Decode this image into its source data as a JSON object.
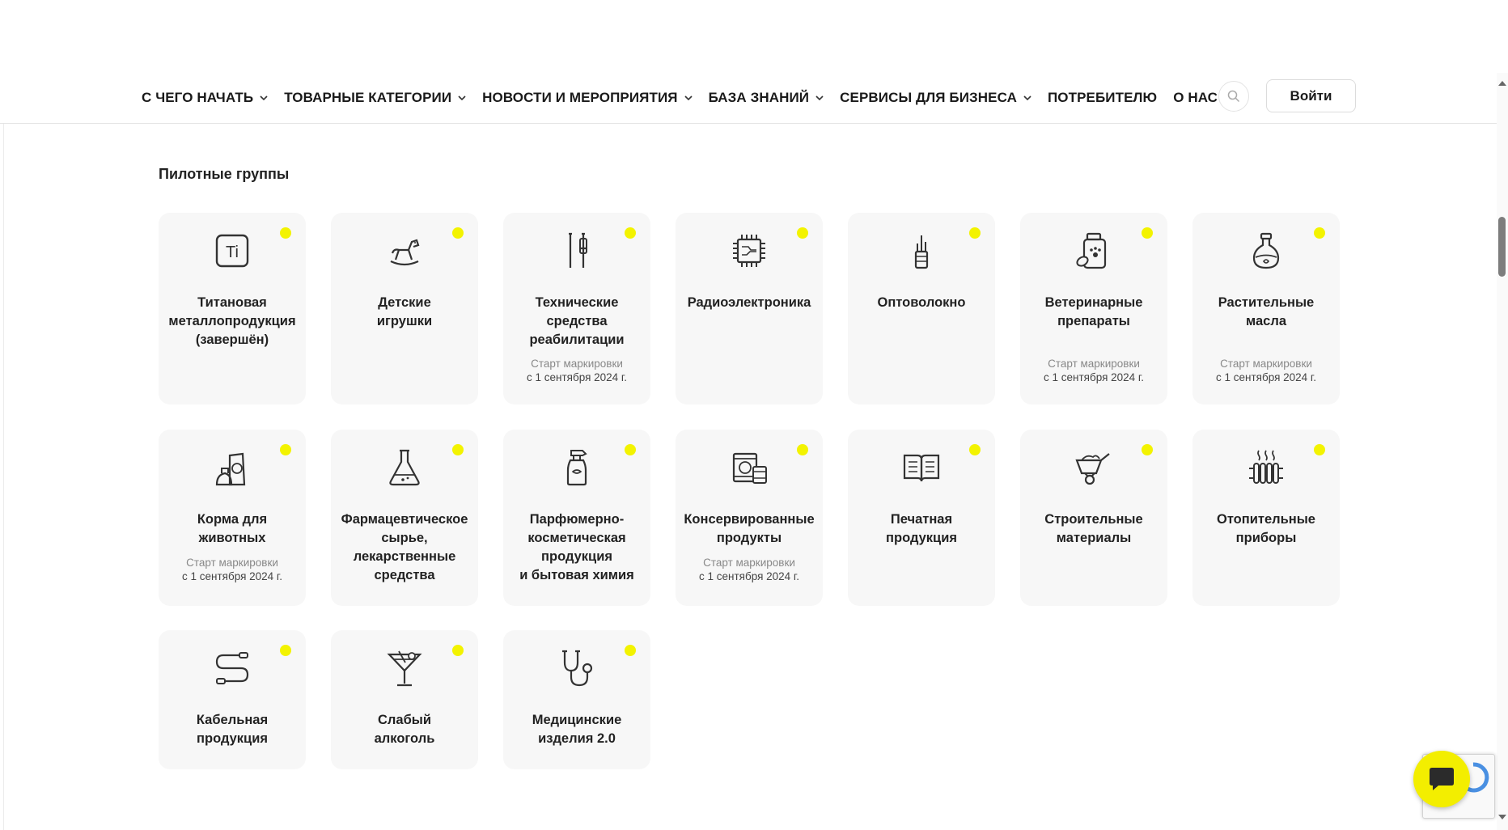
{
  "nav": {
    "items": [
      {
        "label": "С ЧЕГО НАЧАТЬ",
        "dropdown": true
      },
      {
        "label": "ТОВАРНЫЕ КАТЕГОРИИ",
        "dropdown": true
      },
      {
        "label": "НОВОСТИ И МЕРОПРИЯТИЯ",
        "dropdown": true
      },
      {
        "label": "БАЗА ЗНАНИЙ",
        "dropdown": true
      },
      {
        "label": "СЕРВИСЫ ДЛЯ БИЗНЕСА",
        "dropdown": true
      },
      {
        "label": "ПОТРЕБИТЕЛЮ",
        "dropdown": false
      },
      {
        "label": "О НАС",
        "dropdown": true
      }
    ],
    "login_label": "Войти",
    "search_icon": "search-icon"
  },
  "section": {
    "title": "Пилотные группы"
  },
  "cards": [
    {
      "icon": "titanium-icon",
      "name": [
        "Титановая",
        "металлопродукция",
        "(завершён)"
      ]
    },
    {
      "icon": "rocking-horse-icon",
      "name": [
        "Детские",
        "игрушки"
      ]
    },
    {
      "icon": "crutches-icon",
      "name": [
        "Технические",
        "средства",
        "реабилитации"
      ],
      "note": "Старт маркировки",
      "date": "с 1 сентября 2024 г."
    },
    {
      "icon": "microchip-icon",
      "name": [
        "Радиоэлектроника"
      ]
    },
    {
      "icon": "fiber-optic-icon",
      "name": [
        "Оптоволокно"
      ]
    },
    {
      "icon": "vet-medicine-icon",
      "name": [
        "Ветеринарные",
        "препараты"
      ],
      "note": "Старт маркировки",
      "date": "с 1 сентября 2024 г."
    },
    {
      "icon": "oil-bottle-icon",
      "name": [
        "Растительные",
        "масла"
      ],
      "note": "Старт маркировки",
      "date": "с 1 сентября 2024 г."
    },
    {
      "icon": "pet-food-icon",
      "name": [
        "Корма для",
        "животных"
      ],
      "note": "Старт маркировки",
      "date": "с 1 сентября 2024 г."
    },
    {
      "icon": "flask-icon",
      "name": [
        "Фармацевтическое",
        "сырье,",
        "лекарственные",
        "средства"
      ]
    },
    {
      "icon": "spray-bottle-icon",
      "name": [
        "Парфюмерно-",
        "косметическая",
        "продукция",
        "и бытовая химия"
      ]
    },
    {
      "icon": "canned-food-icon",
      "name": [
        "Консервированные",
        "продукты"
      ],
      "note": "Старт маркировки",
      "date": "с 1 сентября 2024 г."
    },
    {
      "icon": "book-icon",
      "name": [
        "Печатная",
        "продукция"
      ]
    },
    {
      "icon": "wheelbarrow-icon",
      "name": [
        "Строительные",
        "материалы"
      ]
    },
    {
      "icon": "radiator-icon",
      "name": [
        "Отопительные",
        "приборы"
      ]
    },
    {
      "icon": "cable-icon",
      "name": [
        "Кабельная",
        "продукция"
      ]
    },
    {
      "icon": "cocktail-icon",
      "name": [
        "Слабый",
        "алкоголь"
      ]
    },
    {
      "icon": "stethoscope-icon",
      "name": [
        "Медицинские",
        "изделия 2.0"
      ]
    }
  ],
  "colors": {
    "accent_dot": "#f3f300",
    "card_bg": "#f7f7f7",
    "chat_button": "#f3ee00"
  }
}
